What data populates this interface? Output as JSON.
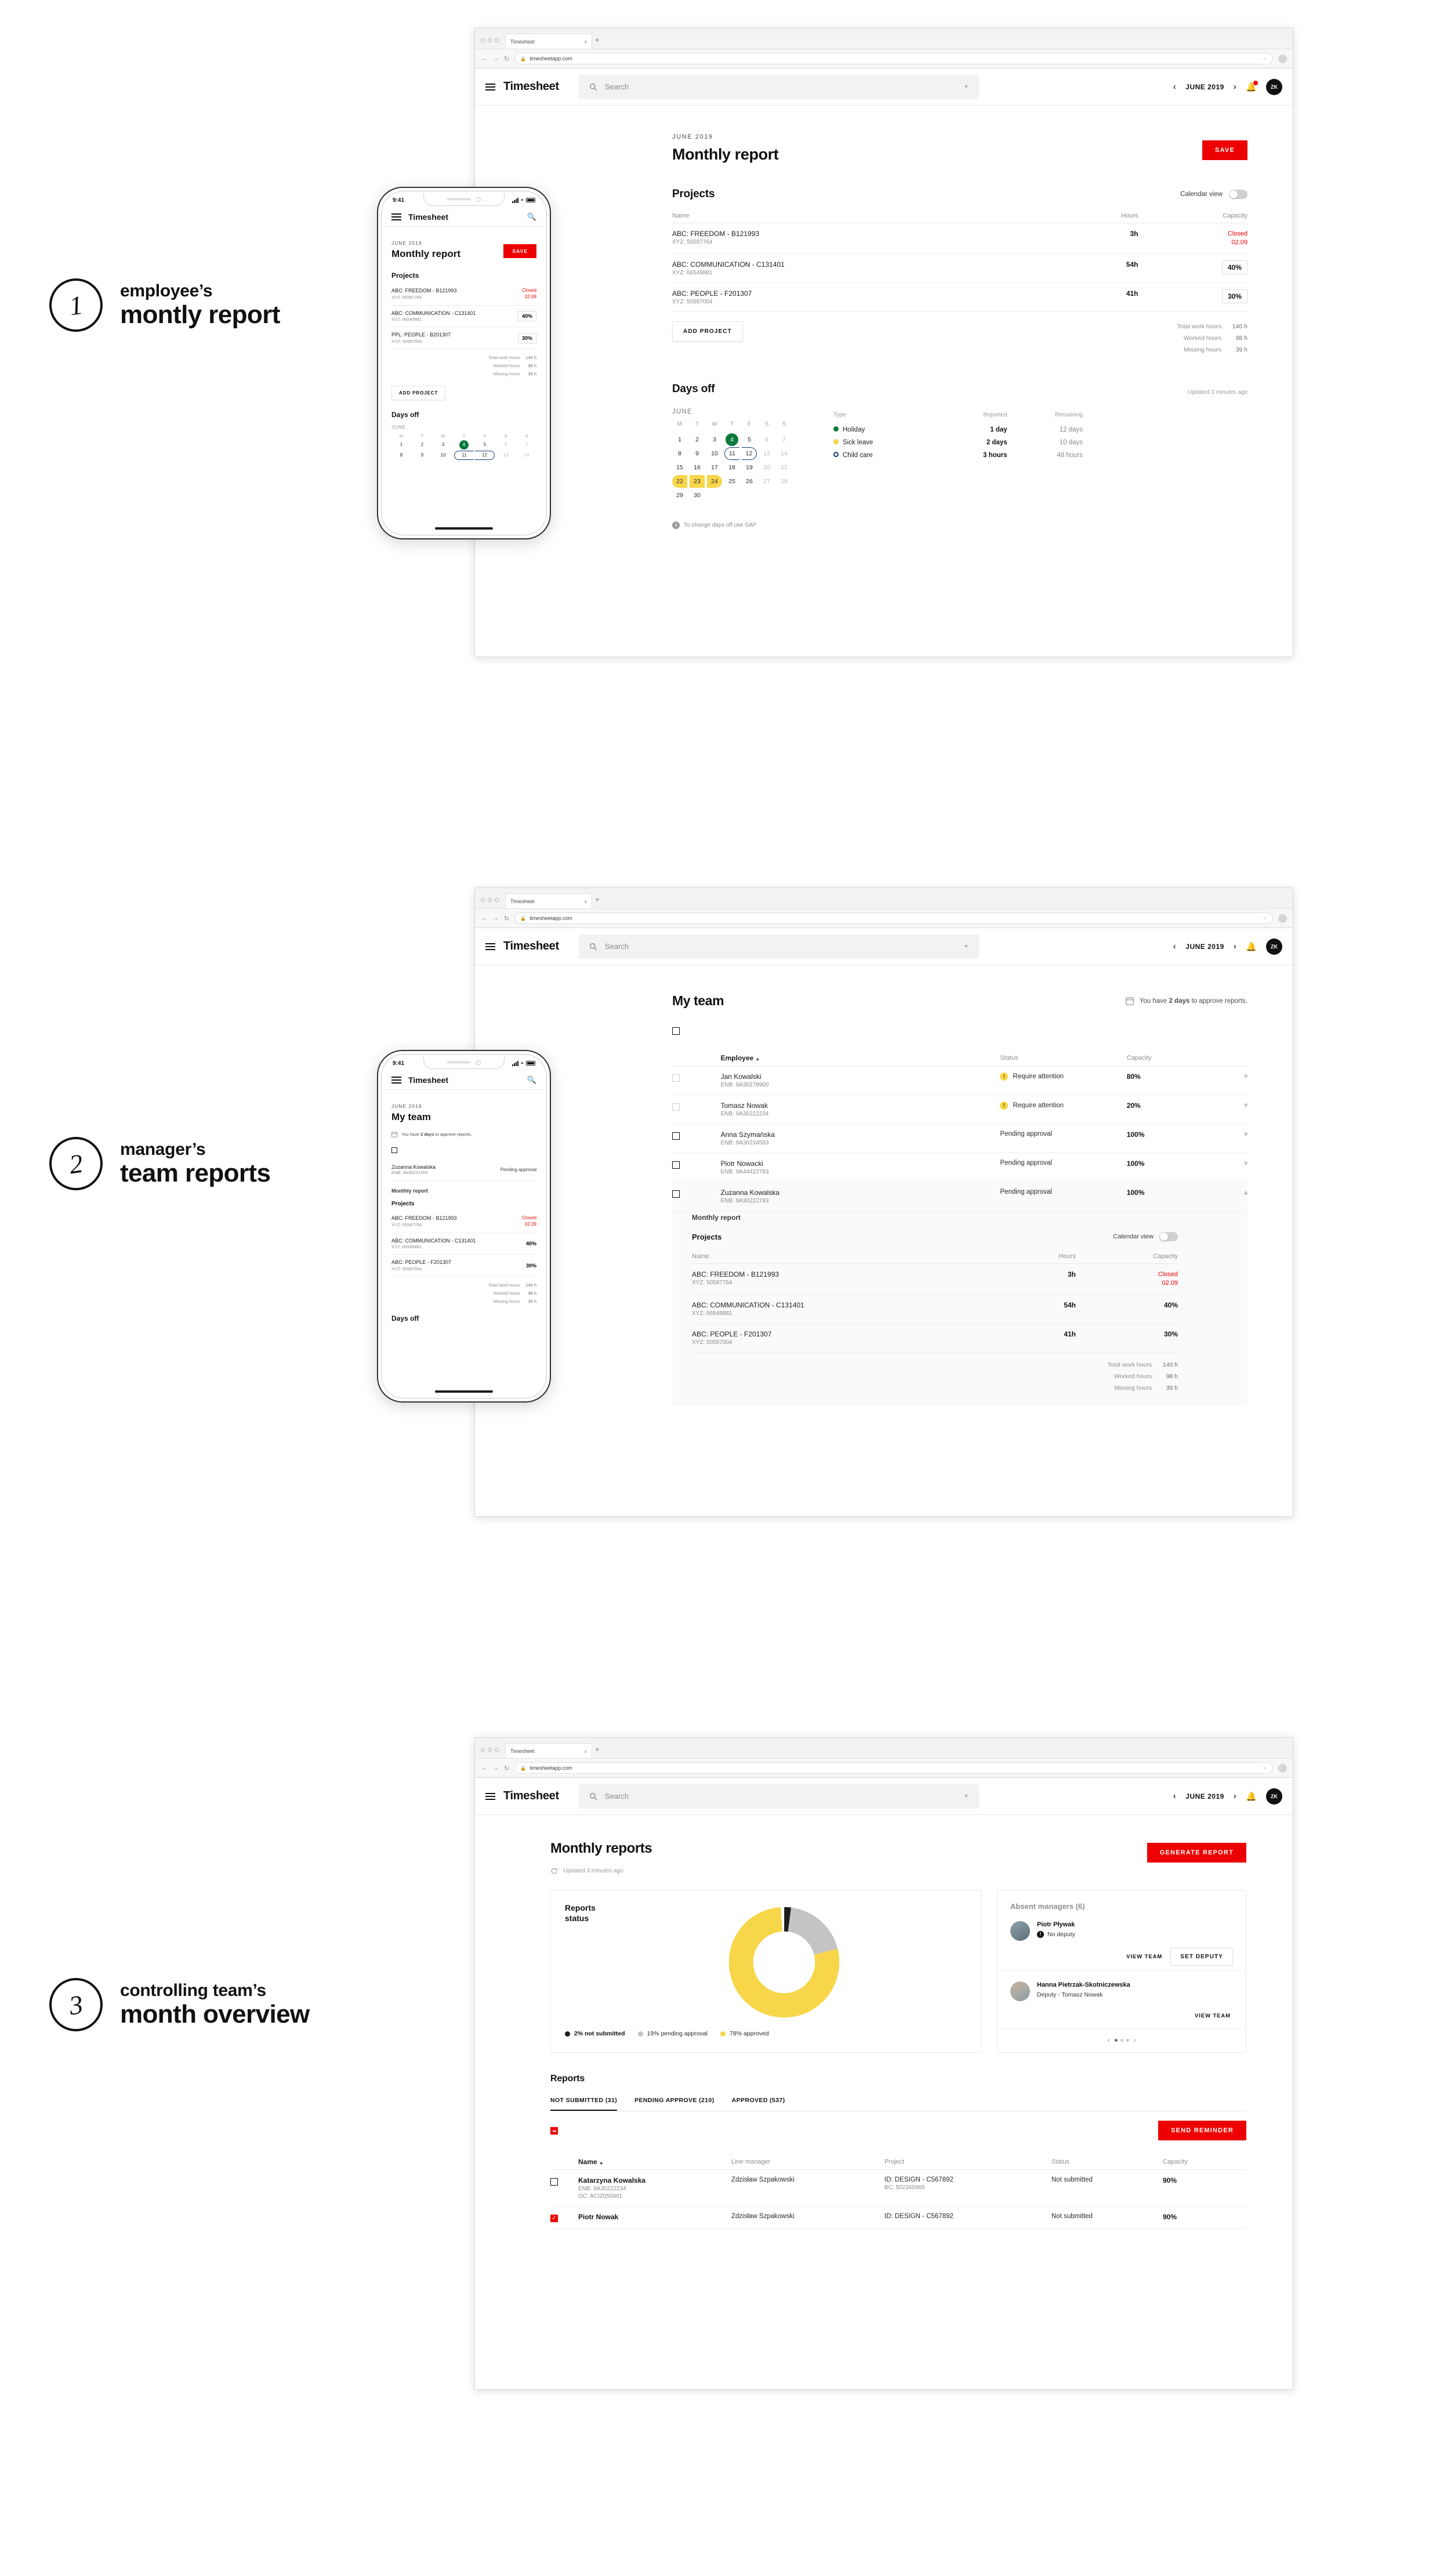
{
  "annotations": [
    {
      "num": "1",
      "small": "employee’s",
      "big": "montly report"
    },
    {
      "num": "2",
      "small": "manager’s",
      "big": "team reports"
    },
    {
      "num": "3",
      "small": "controlling team’s",
      "big": "month overview"
    }
  ],
  "browser": {
    "tab_title": "Timesheet",
    "tab_close": "x",
    "new_tab": "+",
    "back": "←",
    "forward": "→",
    "reload": "↻",
    "lock": "🔒",
    "url": "timesheetapp.com",
    "star": "☆"
  },
  "app_header": {
    "title": "Timesheet",
    "search_placeholder": "Search",
    "month": "JUNE 2019",
    "prev": "‹",
    "next": "›",
    "avatar_initials": "ZK"
  },
  "screen1": {
    "eyebrow": "JUNE 2019",
    "title": "Monthly report",
    "save_label": "SAVE",
    "projects_heading": "Projects",
    "calendar_view_label": "Calendar view",
    "columns": {
      "name": "Name",
      "hours": "Hours",
      "capacity": "Capacity"
    },
    "rows": [
      {
        "name": "ABC: FREEDOM - B121993",
        "sub": "XYZ: 50587764",
        "hours": "3h",
        "capacity": "Closed",
        "capacity2": "02.09",
        "closed": true
      },
      {
        "name": "ABC: COMMUNICATION - C131401",
        "sub": "XYZ: 66549881",
        "hours": "54h",
        "capacity": "40%",
        "closed": false
      },
      {
        "name": "ABC: PEOPLE - F201307",
        "sub": "XYZ: 50587004",
        "hours": "41h",
        "capacity": "30%",
        "closed": false
      }
    ],
    "add_project_label": "ADD PROJECT",
    "totals": [
      {
        "label": "Total work hours",
        "value": "140 h"
      },
      {
        "label": "Worked hours",
        "value": "98 h"
      },
      {
        "label": "Missing hours",
        "value": "39 h"
      }
    ],
    "days_off_heading": "Days off",
    "updated": "Updated 3 minutes ago",
    "calendar_month": "JUNE",
    "dow": [
      "M",
      "T",
      "W",
      "T",
      "F",
      "S",
      "S"
    ],
    "legend_columns": {
      "type": "Type",
      "reported": "Reported",
      "remaining": "Remaining"
    },
    "legend": [
      {
        "type": "Holiday",
        "reported": "1 day",
        "remaining": "12 days",
        "color": "#0a7a3c",
        "hollow": false
      },
      {
        "type": "Sick leave",
        "reported": "2 days",
        "remaining": "10 days",
        "color": "#f7d64a",
        "hollow": false
      },
      {
        "type": "Child care",
        "reported": "3 hours",
        "remaining": "48 hours",
        "color": "#103a7a",
        "hollow": true
      }
    ],
    "sap_note": "To change days off  use SAP",
    "info_glyph": "i"
  },
  "phone1": {
    "time": "9:41",
    "title": "Timesheet",
    "eyebrow": "JUNE 2019",
    "heading": "Monthly report",
    "save_label": "SAVE",
    "projects_heading": "Projects",
    "rows": [
      {
        "name": "ABC: FREEDOM - B121993",
        "sub": "XYZ: 50587764",
        "capacity": "Closed",
        "capacity2": "02.09",
        "closed": true
      },
      {
        "name": "ABC: COMMUNICATION - C131401",
        "sub": "XYZ: 66549881",
        "capacity": "40%",
        "closed": false
      },
      {
        "name": "PPL: PEOPLE - B201307",
        "sub": "XYZ: 50587004",
        "capacity": "30%",
        "closed": false
      }
    ],
    "totals": [
      {
        "label": "Total work hours",
        "value": "140 h"
      },
      {
        "label": "Worked hours",
        "value": "98 h"
      },
      {
        "label": "Missing hours",
        "value": "39 h"
      }
    ],
    "add_project_label": "ADD PROJECT",
    "days_off_heading": "Days off",
    "calendar_month": "JUNE",
    "dow": [
      "M",
      "T",
      "W",
      "T",
      "F",
      "S",
      "S"
    ]
  },
  "screen2": {
    "title": "My team",
    "approve_note_pre": "You have ",
    "approve_note_bold": "2 days",
    "approve_note_post": " to approve reports.",
    "columns": {
      "employee": "Employee",
      "status": "Status",
      "capacity": "Capacity"
    },
    "sort_arrow": "▲",
    "rows": [
      {
        "name": "Jan Kowalski",
        "sub": "ENB: 9A30278900",
        "status": "Require attention",
        "warn": true,
        "capacity": "80%",
        "expanded": false
      },
      {
        "name": "Tomasz Nowak",
        "sub": "ENB: 9A30222234",
        "status": "Require attention",
        "warn": true,
        "capacity": "20%",
        "expanded": false
      },
      {
        "name": "Anna Szymańska",
        "sub": "ENB: 9A30234583",
        "status": "Pending approval",
        "warn": false,
        "capacity": "100%",
        "expanded": false
      },
      {
        "name": "Piotr Nowacki",
        "sub": "ENB: 9A44422783",
        "status": "Pending approval",
        "warn": false,
        "capacity": "100%",
        "expanded": false
      },
      {
        "name": "Zuzanna Kowalska",
        "sub": "ENB: 9A30222783",
        "status": "Pending approval",
        "warn": false,
        "capacity": "100%",
        "expanded": true
      }
    ],
    "detail": {
      "heading": "Monthly report",
      "projects_heading": "Projects",
      "calendar_view_label": "Calendar view",
      "columns": {
        "name": "Name",
        "hours": "Hours",
        "capacity": "Capacity"
      },
      "rows": [
        {
          "name": "ABC: FREEDOM - B121993",
          "sub": "XYZ: 50587764",
          "hours": "3h",
          "capacity": "Closed",
          "capacity2": "02.09",
          "closed": true
        },
        {
          "name": "ABC: COMMUNICATION - C131401",
          "sub": "XYZ: 66549881",
          "hours": "54h",
          "capacity": "40%",
          "closed": false
        },
        {
          "name": "ABC: PEOPLE - F201307",
          "sub": "XYZ: 50587004",
          "hours": "41h",
          "capacity": "30%",
          "closed": false
        }
      ],
      "totals": [
        {
          "label": "Total work hours",
          "value": "140 h"
        },
        {
          "label": "Worked hours",
          "value": "98 h"
        },
        {
          "label": "Missing hours",
          "value": "39 h"
        }
      ]
    }
  },
  "phone2": {
    "time": "9:41",
    "title": "Timesheet",
    "eyebrow": "JUNE 2019",
    "heading": "My team",
    "approve_note_pre": "You have ",
    "approve_note_bold": "2 days",
    "approve_note_post": " to approve reports.",
    "employee": {
      "name": "Zuzanna Kowalska",
      "sub": "ENB: 9A30222783",
      "status": "Pending approval"
    },
    "report_heading": "Monthly report",
    "projects_heading": "Projects",
    "rows": [
      {
        "name": "ABC: FREEDOM - B121993",
        "sub": "XYZ: 50587764",
        "capacity": "Closed",
        "capacity2": "02.09",
        "closed": true
      },
      {
        "name": "ABC: COMMUNICATION - C131401",
        "sub": "XYZ: 66549881",
        "capacity": "40%",
        "closed": false
      },
      {
        "name": "ABC: PEOPLE - F201307",
        "sub": "XYZ: 50587004",
        "capacity": "30%",
        "closed": false
      }
    ],
    "totals": [
      {
        "label": "Total work hours",
        "value": "140 h"
      },
      {
        "label": "Worked hours",
        "value": "98 h"
      },
      {
        "label": "Missing hours",
        "value": "39 h"
      }
    ],
    "days_off_heading": "Days off"
  },
  "screen3": {
    "title": "Monthly reports",
    "updated": "Updated 3 minutes ago",
    "generate_label": "GENERATE REPORT",
    "chart_card_title_l1": "Reports",
    "chart_card_title_l2": "status",
    "absent_title": "Absent managers (6)",
    "managers": [
      {
        "name": "Piotr Pływak",
        "deputy": "No deputy",
        "no_deputy": true,
        "actions": [
          "VIEW TEAM",
          "SET DEPUTY"
        ]
      },
      {
        "name": "Hanna Pietrzak-Skotniczewska",
        "deputy": "Deputy - Tomasz Nowak",
        "no_deputy": false,
        "actions": [
          "VIEW TEAM"
        ]
      }
    ],
    "reports_heading": "Reports",
    "tabs": [
      {
        "label": "NOT SUBMITTED (31)",
        "active": true
      },
      {
        "label": "PENDING APPROVE (210)",
        "active": false
      },
      {
        "label": "APPROVED (537)",
        "active": false
      }
    ],
    "send_reminder_label": "SEND REMINDER",
    "columns": {
      "name": "Name",
      "line_manager": "Line manager",
      "project": "Project",
      "status": "Status",
      "capacity": "Capacity"
    },
    "sort_arrow": "▲",
    "rows": [
      {
        "name": "Katarzyna Kowalska",
        "sub1": "ENB: 9A30222234",
        "sub2": "OC: ACIZ055801",
        "manager": "Zdzisław Szpakowski",
        "project": "ID: DESIGN - C567892",
        "project_sub": "BC: 502345865",
        "status": "Not submitted",
        "capacity": "90%",
        "checked": false
      },
      {
        "name": "Piotr Nowak",
        "sub1": "",
        "sub2": "",
        "manager": "Zdzisław Szpakowski",
        "project": "ID: DESIGN - C567892",
        "project_sub": "",
        "status": "Not submitted",
        "capacity": "90%",
        "checked": true
      }
    ]
  },
  "chart_data": {
    "type": "pie",
    "title": "Reports status",
    "labels": [
      "not submitted",
      "pending approval",
      "approved"
    ],
    "values": [
      2,
      19,
      78
    ],
    "value_labels": [
      "2% not submitted",
      "19% pending approval",
      "78% approved"
    ],
    "colors": [
      "#1c1c1c",
      "#c4c4c4",
      "#f7d64a"
    ],
    "legend_position": "bottom",
    "donut": true,
    "inner_radius_ratio": 0.52
  }
}
